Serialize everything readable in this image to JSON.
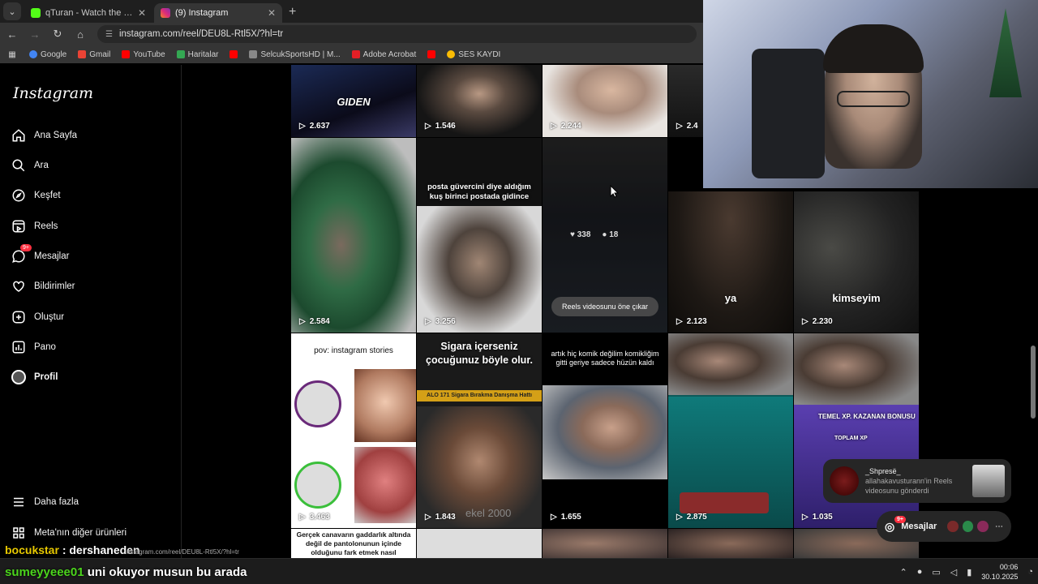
{
  "browser": {
    "tabs": [
      {
        "title": "qTuran - Watch the VOD on Kick",
        "active": false,
        "favicon_color": "#53fc18"
      },
      {
        "title": "(9) Instagram",
        "active": true,
        "favicon_color": "#d6249f"
      }
    ],
    "url": "instagram.com/reel/DEU8L-Rtl5X/?hl=tr",
    "bookmarks": [
      {
        "label": "Google",
        "color": "#4285f4"
      },
      {
        "label": "Gmail",
        "color": "#ea4335"
      },
      {
        "label": "YouTube",
        "color": "#ff0000"
      },
      {
        "label": "Haritalar",
        "color": "#34a853"
      },
      {
        "label": "",
        "color": "#ff0000"
      },
      {
        "label": "SelcukSportsHD | M...",
        "color": "#888888"
      },
      {
        "label": "Adobe Acrobat",
        "color": "#e31f26"
      },
      {
        "label": "",
        "color": "#ff0000"
      },
      {
        "label": "SES KAYDI",
        "color": "#fbbc04"
      }
    ]
  },
  "sidebar": {
    "logo": "Instagram",
    "items": [
      {
        "label": "Ana Sayfa",
        "icon": "home-icon"
      },
      {
        "label": "Ara",
        "icon": "search-icon"
      },
      {
        "label": "Keşfet",
        "icon": "compass-icon"
      },
      {
        "label": "Reels",
        "icon": "reels-icon"
      },
      {
        "label": "Mesajlar",
        "icon": "messenger-icon",
        "badge": "9+"
      },
      {
        "label": "Bildirimler",
        "icon": "heart-icon"
      },
      {
        "label": "Oluştur",
        "icon": "plus-square-icon"
      },
      {
        "label": "Pano",
        "icon": "dashboard-icon"
      },
      {
        "label": "Profil",
        "icon": "avatar"
      }
    ],
    "more": "Daha fazla",
    "meta": "Meta'nın diğer ürünleri"
  },
  "grid": {
    "row1": [
      "2.637",
      "1.546",
      "2.244",
      "2.4"
    ],
    "row1_caption": "GIDEN",
    "row2": [
      "2.584",
      "3.256",
      "",
      "2.123",
      "2.230"
    ],
    "row2_captions": {
      "posta": "posta güvercini diye aldığım kuş birinci postada gidince",
      "ya": "ya",
      "kimseyim": "kimseyim"
    },
    "hover": {
      "likes": "338",
      "comments": "18",
      "button": "Reels videosunu öne çıkar"
    },
    "row3": [
      "3.463",
      "1.843",
      "1.655",
      "2.875",
      "1.035"
    ],
    "row3_captions": {
      "pov": "pov: instagram stories",
      "sigara": "Sigara içerseniz çocuğunuz böyle olur.",
      "alo": "ALO 171 Sigara Bırakma Danışma Hattı",
      "komik": "artık hiç komik değilim komikliğim gitti geriye sadece hüzün kaldı",
      "temel": "TEMEL XP. KAZANAN BONUSU",
      "toplam": "TOPLAM XP",
      "ekel": "ekel 2000"
    },
    "row4_caption": "Gerçek canavarın gaddarlık altında değil de pantolonunun içinde olduğunu fark etmek nasıl hissettiriyor"
  },
  "notification": {
    "user": "_Shpresë_",
    "text": "allahakavusturann'in Reels videosunu gönderdi"
  },
  "messages_pill": {
    "label": "Mesajlar",
    "badge": "9+"
  },
  "stream_chat": [
    {
      "user": "bocukstar",
      "message": ": dershaneden"
    },
    {
      "user": "sumeyyeee01",
      "message": "uni okuyor musun bu arada"
    }
  ],
  "status_url": "nstagram.com/reel/DEU8L-Rtl5X/?hl=tr",
  "taskbar": {
    "time": "00:06",
    "date": "30.10.2025"
  }
}
